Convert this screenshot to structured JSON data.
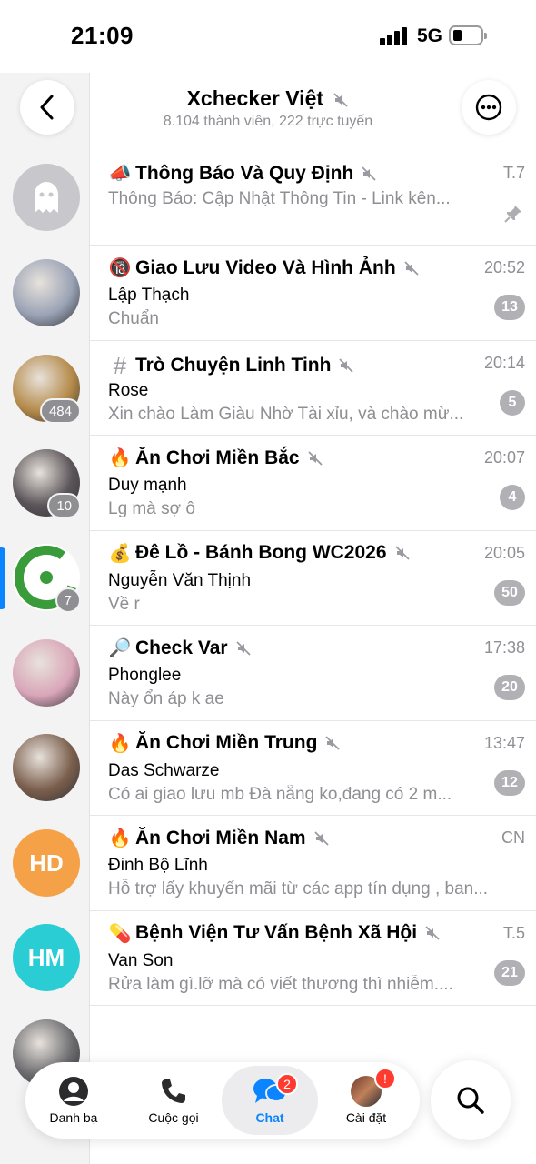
{
  "status_bar": {
    "time": "21:09",
    "network": "5G"
  },
  "header": {
    "title": "Xchecker Việt",
    "subtitle": "8.104 thành viên, 222 trực tuyến",
    "back_icon": "chevron-left-icon",
    "more_icon": "more-horizontal-icon"
  },
  "rail": {
    "items": [
      {
        "name": "ghost",
        "badge": "",
        "color": "#c7c7cc"
      },
      {
        "name": "photo-1",
        "badge": "",
        "color": "#9aa3b5"
      },
      {
        "name": "photo-2",
        "badge": "484",
        "color": "#b58b4a"
      },
      {
        "name": "photo-3",
        "badge": "10",
        "color": "#5b5559"
      },
      {
        "name": "logo-c",
        "badge": "7",
        "color": "#3a9b3a"
      },
      {
        "name": "photo-4",
        "badge": "",
        "color": "#d9a6b8"
      },
      {
        "name": "photo-5",
        "badge": "",
        "color": "#7b5f4d"
      },
      {
        "name": "HD",
        "badge": "",
        "color": "#f5a147"
      },
      {
        "name": "HM",
        "badge": "",
        "color": "#29cdd3"
      },
      {
        "name": "photo-6",
        "badge": "",
        "color": "#6d6d70"
      }
    ]
  },
  "chats": [
    {
      "emoji": "📣",
      "title": "Thông Báo Và Quy Định",
      "time": "T.7",
      "sender": "",
      "preview": "Thông Báo: Cập Nhật Thông Tin - Link kên...",
      "count": "",
      "pinned": true
    },
    {
      "emoji": "🔞",
      "title": "Giao Lưu Video Và Hình Ảnh",
      "time": "20:52",
      "sender": "Lập Thạch",
      "preview": "Chuẩn",
      "count": "13",
      "pinned": false
    },
    {
      "emoji": "#",
      "title": "Trò Chuyện Linh Tinh",
      "time": "20:14",
      "sender": "Rose",
      "preview": "Xin chào Làm Giàu Nhờ Tài xỉu, và chào mừ...",
      "count": "5",
      "pinned": false
    },
    {
      "emoji": "🔥",
      "title": "Ăn Chơi Miền Bắc",
      "time": "20:07",
      "sender": "Duy mạnh",
      "preview": "Lg mà sợ ô",
      "count": "4",
      "pinned": false
    },
    {
      "emoji": "💰",
      "title": "Đê Lồ - Bánh Bong WC2026",
      "time": "20:05",
      "sender": "Nguyễn Văn Thịnh",
      "preview": "Về r",
      "count": "50",
      "pinned": false
    },
    {
      "emoji": "🔎",
      "title": "Check Var",
      "time": "17:38",
      "sender": "Phonglee",
      "preview": "Này ổn áp k ae",
      "count": "20",
      "pinned": false
    },
    {
      "emoji": "🔥",
      "title": "Ăn Chơi Miền Trung",
      "time": "13:47",
      "sender": "Das Schwarze",
      "preview": "Có ai giao lưu mb Đà nẵng ko,đang có 2 m...",
      "count": "12",
      "pinned": false
    },
    {
      "emoji": "🔥",
      "title": "Ăn Chơi Miền Nam",
      "time": "CN",
      "sender": "Đinh Bộ Lĩnh",
      "preview": "Hỗ trợ lấy khuyến mãi từ các app tín dụng , ban...",
      "count": "",
      "pinned": false
    },
    {
      "emoji": "💊",
      "title": "Bệnh Viện Tư Vấn Bệnh Xã Hội",
      "time": "T.5",
      "sender": "Van Son",
      "preview": "Rửa làm gì.lỡ mà có viết thương thì nhiễm....",
      "count": "21",
      "pinned": false
    }
  ],
  "tabbar": {
    "tabs": [
      {
        "label": "Danh bạ",
        "icon": "person-icon",
        "badge": ""
      },
      {
        "label": "Cuộc gọi",
        "icon": "phone-icon",
        "badge": ""
      },
      {
        "label": "Chat",
        "icon": "chat-bubbles-icon",
        "badge": "2"
      },
      {
        "label": "Cài đặt",
        "icon": "profile-avatar-icon",
        "badge": "!"
      }
    ],
    "search_icon": "search-icon"
  },
  "colors": {
    "accent": "#0a84ff",
    "badge_red": "#ff3b30",
    "muted_badge": "#b0b0b5",
    "secondary_text": "#8e8e93"
  }
}
